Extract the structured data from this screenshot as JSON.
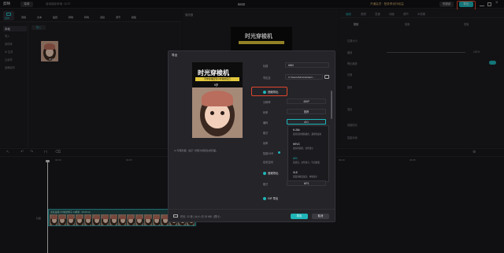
{
  "app": {
    "name": "剪映",
    "menu": "菜单",
    "autosave": "自动保存本地: 12:27",
    "project_title": "6840",
    "vip_text": "开通会员 · 登录享创作权益",
    "shortcut_label": "快捷键",
    "export_label": "导出"
  },
  "left_tabs": [
    "媒体",
    "音频",
    "文本",
    "贴纸",
    "特效",
    "转场",
    "滤镜",
    "调节",
    "模板"
  ],
  "left_sidebar": {
    "items": [
      "本地",
      "导入",
      "素材库",
      "AI 生成",
      "云素材",
      "品牌素材"
    ],
    "import_button": "导入"
  },
  "media_panel": {
    "duration": "00:15"
  },
  "player": {
    "title": "播放器",
    "video_text": "时光穿梭机"
  },
  "right_panel": {
    "tabs": [
      "画面",
      "音频",
      "变速",
      "动画",
      "调节",
      "AI效果"
    ],
    "subtabs": [
      "基础",
      "抠像",
      "蒙版"
    ],
    "rows": [
      "位置大小",
      "缩放",
      "等比缩放",
      "位置",
      "旋转",
      "混合",
      "视频防抖",
      "智能补帧"
    ],
    "scale_value": "100%"
  },
  "export_dialog": {
    "title": "导出",
    "cover_title": "时光穿梭机",
    "cover_subtitle": "带你穿越回到小时候的自己",
    "cover_note": "5岁",
    "preview_text": "AI 专属封面 · 提示: 智能为视频生成封面。",
    "fields": {
      "title_label": "标题",
      "title_value": "6840",
      "path_label": "导出至",
      "path_value": "C:/Users/Administrator/..."
    },
    "video_export": {
      "label": "视频导出",
      "resolution_label": "分辨率",
      "resolution_value": "480P",
      "bitrate_label": "码率",
      "bitrate_value": "推荐",
      "codec_label": "编码",
      "codec_value": "AV1",
      "format_label": "格式",
      "framerate_label": "帧率",
      "color_label": "智能HDR",
      "hdr_label": "色彩空间"
    },
    "codec_options": [
      {
        "name": "H.264",
        "desc": "最常见的视频格式，兼容性最好"
      },
      {
        "name": "HEVC",
        "desc": "更好的画质，文件更小"
      },
      {
        "name": "AV1",
        "desc": "画质高，文件更小，导出更慢"
      },
      {
        "name": "VLE",
        "desc": "画面清晰度最高，体积更小"
      }
    ],
    "audio_export": {
      "label": "音频导出",
      "format_label": "格式",
      "format_value": "MP3"
    },
    "gif_export": {
      "label": "GIF 导出"
    },
    "footer_info": "时长: 12 秒 | 大小: 约 19 MB（预计）",
    "export_button": "导出",
    "cancel_button": "取消"
  },
  "timeline": {
    "clip_label": "这就是我小时候的样子-AI换脸 · 00:00:12",
    "cover_label": "封面",
    "ruler": [
      "00:00",
      "00:05",
      "00:10",
      "00:15",
      "00:20",
      "00:25"
    ]
  },
  "colors": {
    "accent": "#1fb5b8",
    "highlight": "#e0452c",
    "background": "#18181b"
  }
}
